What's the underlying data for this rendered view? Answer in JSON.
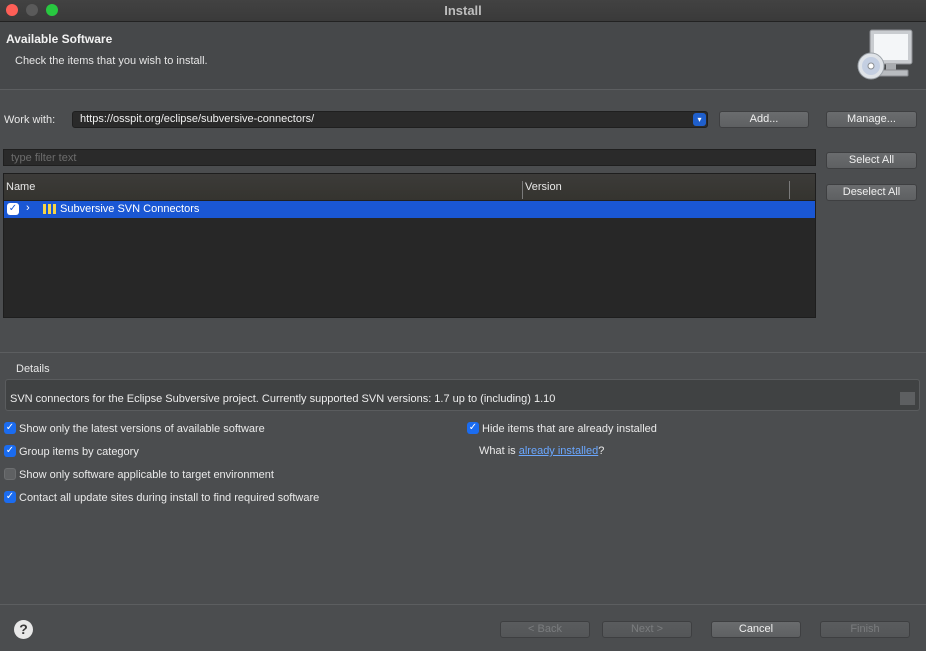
{
  "window": {
    "title": "Install"
  },
  "banner": {
    "title": "Available Software",
    "subtitle": "Check the items that you wish to install."
  },
  "work_with": {
    "label": "Work with:",
    "value": "https://osspit.org/eclipse/subversive-connectors/",
    "add_label": "Add...",
    "manage_label": "Manage..."
  },
  "filter": {
    "placeholder": "type filter text"
  },
  "selection": {
    "select_all_label": "Select All",
    "deselect_all_label": "Deselect All"
  },
  "table": {
    "columns": [
      "Name",
      "Version"
    ],
    "rows": [
      {
        "name": "Subversive SVN Connectors",
        "version": "",
        "checked": true
      }
    ]
  },
  "details": {
    "label": "Details",
    "text": "SVN connectors for the Eclipse Subversive project. Currently supported SVN versions: 1.7 up to (including) 1.10"
  },
  "options": {
    "latest_versions": {
      "label": "Show only the latest versions of available software",
      "checked": true
    },
    "group_by_category": {
      "label": "Group items by category",
      "checked": true
    },
    "target_env": {
      "label": "Show only software applicable to target environment",
      "checked": false
    },
    "contact_sites": {
      "label": "Contact all update sites during install to find required software",
      "checked": true
    },
    "hide_installed": {
      "label": "Hide items that are already installed",
      "checked": true
    },
    "what_is_prefix": "What is ",
    "what_is_link": "already installed",
    "what_is_suffix": "?"
  },
  "footer": {
    "back_label": "< Back",
    "next_label": "Next >",
    "cancel_label": "Cancel",
    "finish_label": "Finish"
  },
  "colors": {
    "accent": "#1a57d4",
    "checkbox": "#1b6cf0",
    "link": "#6aa7ff"
  }
}
